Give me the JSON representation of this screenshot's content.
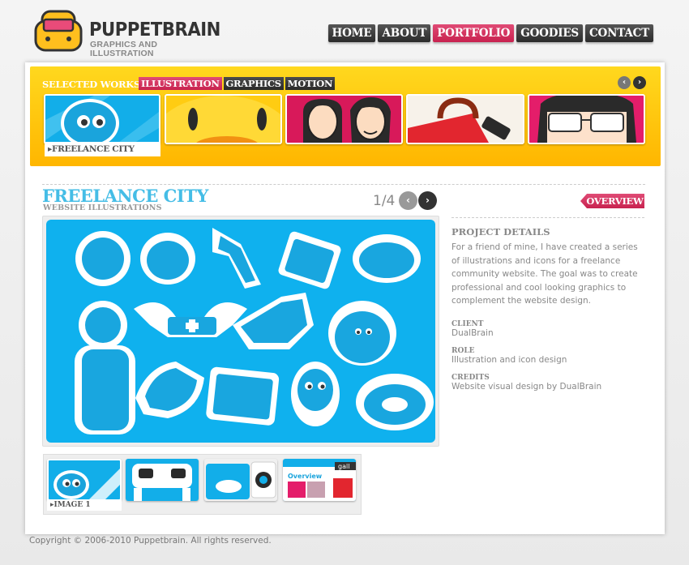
{
  "brand": {
    "title": "PUPPETBRAIN",
    "subtitle": "GRAPHICS AND ILLUSTRATION",
    "accent": "#c8224f",
    "logo_color": "#ffbf1e"
  },
  "nav": {
    "items": [
      {
        "label": "HOME"
      },
      {
        "label": "ABOUT"
      },
      {
        "label": "PORTFOLIO",
        "active": true
      },
      {
        "label": "GOODIES"
      },
      {
        "label": "CONTACT"
      }
    ]
  },
  "works": {
    "label": "SELECTED WORKS",
    "categories": [
      {
        "label": "ILLUSTRATION",
        "active": true
      },
      {
        "label": "GRAPHICS"
      },
      {
        "label": "MOTION"
      }
    ],
    "prev_icon": "chevron-left-icon",
    "next_icon": "chevron-right-icon",
    "selected_caption": "▸FREELANCE CITY"
  },
  "project": {
    "title": "FREELANCE CITY",
    "subtitle": "WEBSITE ILLUSTRATIONS",
    "pager": "1/4",
    "overview_label": "OVERVIEW",
    "image_caption": "▸IMAGE 1",
    "details_heading": "PROJECT DETAILS",
    "description": "For a friend of mine, I have created a series of illustrations and icons for a freelance community website. The goal was to create professional and cool looking graphics to complement the website design.",
    "client_label": "CLIENT",
    "client": "DualBrain",
    "role_label": "ROLE",
    "role": "Illustration and icon design",
    "credits_label": "CREDITS",
    "credits": "Website visual design by DualBrain",
    "thumb4_tab": "gall",
    "thumb4_title": "Overview"
  },
  "footer": {
    "copyright": "Copyright © 2006-2010 Puppetbrain. All rights reserved."
  }
}
